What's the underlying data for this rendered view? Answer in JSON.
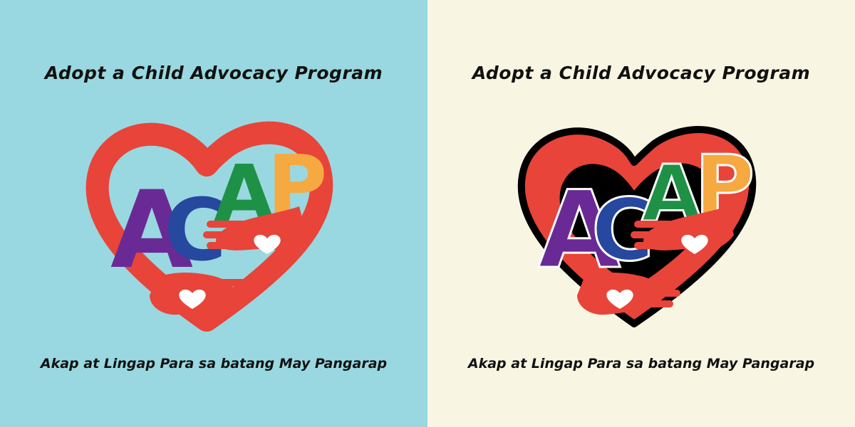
{
  "panels": [
    {
      "title": "Adopt a Child Advocacy Program",
      "logo_letters": [
        "A",
        "C",
        "A",
        "P"
      ],
      "tagline": "Akap at Lingap Para sa batang May Pangarap"
    },
    {
      "title": "Adopt a Child Advocacy Program",
      "logo_letters": [
        "A",
        "C",
        "A",
        "P"
      ],
      "tagline": "Akap at Lingap Para sa batang May Pangarap"
    }
  ],
  "colors": {
    "panel_left_bg": "#99d8e0",
    "panel_right_bg": "#f8f6e2",
    "heart_red": "#e8443a",
    "letter_a1": "#6a2a96",
    "letter_c": "#26489e",
    "letter_a2": "#1f9146",
    "letter_p": "#f6a940",
    "text": "#111111"
  },
  "icons": [
    "heart-icon",
    "hand-icon"
  ]
}
